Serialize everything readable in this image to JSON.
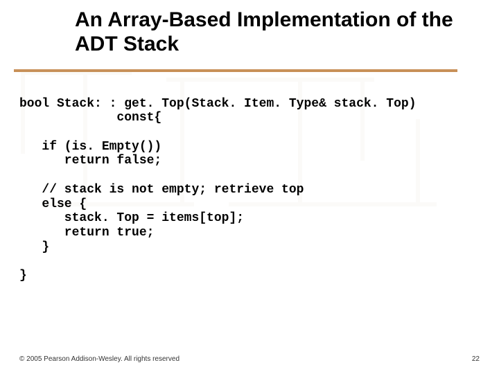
{
  "title": "An Array-Based Implementation of the ADT Stack",
  "code": {
    "l1": "bool Stack: : get. Top(Stack. Item. Type& stack. Top)",
    "l2": "             const{",
    "l3": "",
    "l4": "   if (is. Empty())",
    "l5": "      return false;",
    "l6": "",
    "l7": "   // stack is not empty; retrieve top",
    "l8": "   else {",
    "l9": "      stack. Top = items[top];",
    "l10": "      return true;",
    "l11": "   }",
    "l12": "",
    "l13": "}"
  },
  "footer": {
    "copyright": "© 2005 Pearson Addison-Wesley. All rights reserved",
    "page": "22"
  }
}
